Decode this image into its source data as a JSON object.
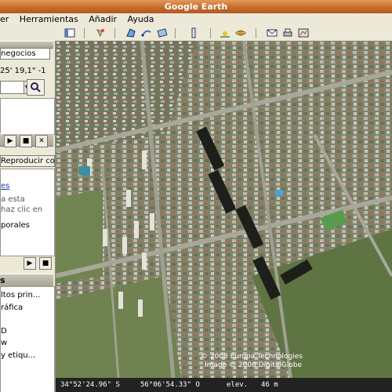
{
  "window": {
    "title": "Google Earth"
  },
  "menu": {
    "items": [
      "er",
      "Herramientas",
      "Añadir",
      "Ayuda"
    ]
  },
  "left": {
    "tab_label": "negocios",
    "coords_value": "25' 19,1\" -1",
    "play_button_label": "Reproducir contenido",
    "tour_link": "es",
    "tour_lines": [
      "a esta",
      "haz clic en",
      "porales"
    ],
    "layers_header": "s",
    "layers": [
      "ltos prin...",
      "ráfica",
      "D",
      "w",
      "y etiqu..."
    ]
  },
  "map": {
    "copyright_line1": "© 2008 Europa Technologies",
    "copyright_line2": "Image © 2008 DigitalGlobe"
  },
  "status": {
    "lat": "34°52'24.96\" S",
    "lon": "56°06'54.33\" O",
    "elev_label": "elev.",
    "elev_value": "46 m"
  }
}
